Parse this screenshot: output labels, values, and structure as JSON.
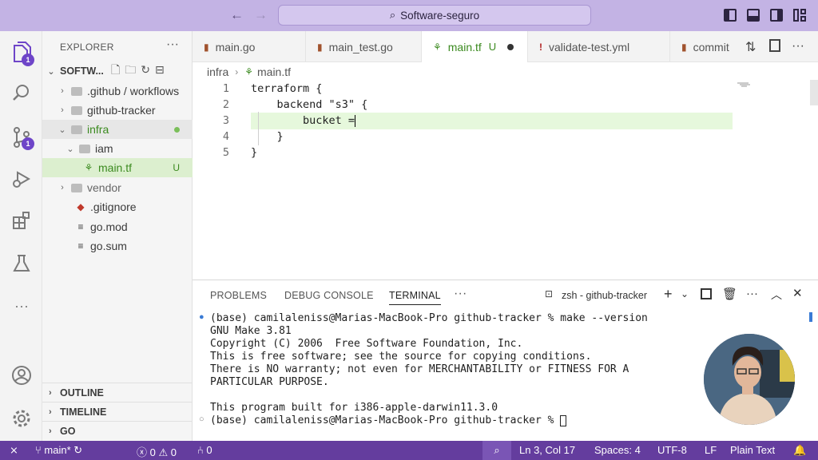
{
  "titlebar": {
    "search_text": "Software-seguro"
  },
  "activity": {
    "explorer_badge": "1",
    "scm_badge": "1"
  },
  "sidebar": {
    "title": "EXPLORER",
    "workspace": "SOFTW...",
    "tree": [
      {
        "label": ".github / workflows"
      },
      {
        "label": "github-tracker"
      },
      {
        "label": "infra"
      },
      {
        "label": "iam"
      },
      {
        "label": "main.tf",
        "status": "U"
      },
      {
        "label": "vendor"
      },
      {
        "label": ".gitignore"
      },
      {
        "label": "go.mod"
      },
      {
        "label": "go.sum"
      }
    ],
    "sections": [
      "OUTLINE",
      "TIMELINE",
      "GO"
    ]
  },
  "tabs": [
    {
      "label": "main.go"
    },
    {
      "label": "main_test.go"
    },
    {
      "label": "main.tf",
      "status": "U"
    },
    {
      "label": "validate-test.yml"
    },
    {
      "label": "commit"
    }
  ],
  "breadcrumb": [
    "infra",
    "main.tf"
  ],
  "editor": {
    "line_numbers": [
      "1",
      "2",
      "3",
      "4",
      "5"
    ],
    "lines": [
      "terraform {",
      "    backend \"s3\" {",
      "        bucket =",
      "    }",
      "}"
    ]
  },
  "panel": {
    "tabs": [
      "PROBLEMS",
      "DEBUG CONSOLE",
      "TERMINAL"
    ],
    "terminal_name": "zsh - github-tracker",
    "terminal_lines": [
      "(base) camilaleniss@Marias-MacBook-Pro github-tracker % make --version",
      "GNU Make 3.81",
      "Copyright (C) 2006  Free Software Foundation, Inc.",
      "This is free software; see the source for copying conditions.",
      "There is NO warranty; not even for MERCHANTABILITY or FITNESS FOR A",
      "PARTICULAR PURPOSE.",
      "",
      "This program built for i386-apple-darwin11.3.0",
      "(base) camilaleniss@Marias-MacBook-Pro github-tracker % "
    ]
  },
  "statusbar": {
    "branch": "main*",
    "problems": "0",
    "warnings": "0",
    "ports": "0",
    "position": "Ln 3, Col 17",
    "spaces": "Spaces: 4",
    "encoding": "UTF-8",
    "eol": "LF",
    "language": "Plain Text"
  },
  "colors": {
    "titlebar_bg": "#c3b3e4",
    "statusbar_bg": "#643d9e",
    "accent_green": "#3b8a1f",
    "badge_purple": "#6e45c8"
  },
  "icons": [
    "explorer-icon",
    "search-icon",
    "source-control-icon",
    "run-debug-icon",
    "extensions-icon",
    "testing-icon",
    "account-icon",
    "settings-gear-icon"
  ]
}
